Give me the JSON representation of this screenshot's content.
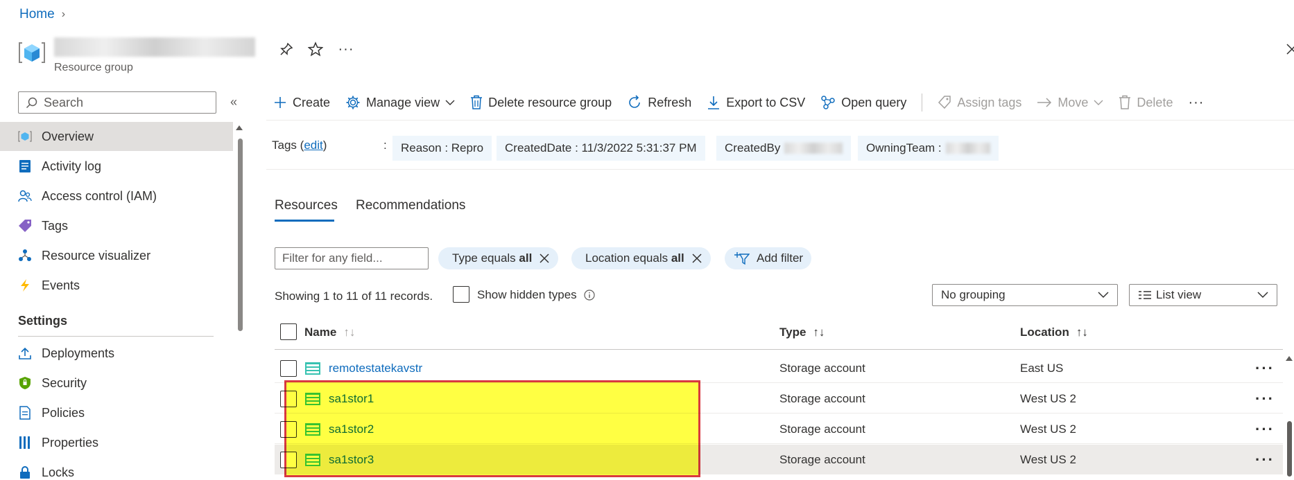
{
  "breadcrumb": {
    "home": "Home"
  },
  "header": {
    "subtitle": "Resource group"
  },
  "sidebar": {
    "search_placeholder": "Search",
    "items": [
      {
        "label": "Overview",
        "icon": "resource-group-icon"
      },
      {
        "label": "Activity log",
        "icon": "activity-log-icon"
      },
      {
        "label": "Access control (IAM)",
        "icon": "people-icon"
      },
      {
        "label": "Tags",
        "icon": "tag-icon"
      },
      {
        "label": "Resource visualizer",
        "icon": "hierarchy-icon"
      },
      {
        "label": "Events",
        "icon": "lightning-icon"
      }
    ],
    "settings_heading": "Settings",
    "settings_items": [
      {
        "label": "Deployments",
        "icon": "upload-icon"
      },
      {
        "label": "Security",
        "icon": "shield-icon"
      },
      {
        "label": "Policies",
        "icon": "policy-icon"
      },
      {
        "label": "Properties",
        "icon": "properties-icon"
      },
      {
        "label": "Locks",
        "icon": "lock-icon"
      }
    ]
  },
  "toolbar": {
    "create": "Create",
    "manage_view": "Manage view",
    "delete_rg": "Delete resource group",
    "refresh": "Refresh",
    "export_csv": "Export to CSV",
    "open_query": "Open query",
    "assign_tags": "Assign tags",
    "move": "Move",
    "delete": "Delete"
  },
  "essentials": {
    "tags_label": "Tags",
    "tags_edit": "edit",
    "tags": [
      "Reason : Repro",
      "CreatedDate : 11/3/2022 5:31:37 PM",
      "CreatedBy",
      "OwningTeam :"
    ]
  },
  "tabs": {
    "resources": "Resources",
    "recommendations": "Recommendations"
  },
  "filters": {
    "placeholder": "Filter for any field...",
    "type_prefix": "Type equals",
    "type_value": "all",
    "location_prefix": "Location equals",
    "location_value": "all",
    "add_filter": "Add filter"
  },
  "records_text": "Showing 1 to 11 of 11 records.",
  "show_hidden": "Show hidden types",
  "grouping": "No grouping",
  "view": "List view",
  "columns": {
    "name": "Name",
    "type": "Type",
    "location": "Location"
  },
  "rows": [
    {
      "name": "remotestatekavstr",
      "type": "Storage account",
      "location": "East US"
    },
    {
      "name": "sa1stor1",
      "type": "Storage account",
      "location": "West US 2"
    },
    {
      "name": "sa1stor2",
      "type": "Storage account",
      "location": "West US 2"
    },
    {
      "name": "sa1stor3",
      "type": "Storage account",
      "location": "West US 2"
    }
  ],
  "colors": {
    "accent": "#0f6cbd",
    "highlight": "#ffff33",
    "highlight_border": "#d6282f"
  }
}
